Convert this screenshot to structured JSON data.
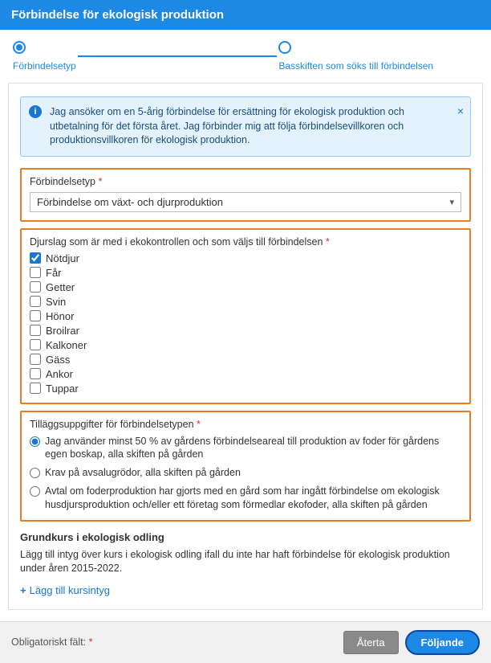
{
  "header": {
    "title": "Förbindelse för ekologisk produktion"
  },
  "stepper": {
    "step1": "Förbindelsetyp",
    "step2": "Basskiften som söks till förbindelsen"
  },
  "info": {
    "text": "Jag ansöker om en 5-årig förbindelse för ersättning för ekologisk produktion och utbetalning för det första året. Jag förbinder mig att följa förbindelsevillkoren och produktionsvillkoren för ekologisk produktion."
  },
  "forbindelsetyp": {
    "label": "Förbindelsetyp",
    "value": "Förbindelse om växt- och djurproduktion"
  },
  "djurslag": {
    "label": "Djurslag som är med i ekokontrollen och som väljs till förbindelsen",
    "items": [
      {
        "label": "Nötdjur",
        "checked": true
      },
      {
        "label": "Får",
        "checked": false
      },
      {
        "label": "Getter",
        "checked": false
      },
      {
        "label": "Svin",
        "checked": false
      },
      {
        "label": "Hönor",
        "checked": false
      },
      {
        "label": "Broilrar",
        "checked": false
      },
      {
        "label": "Kalkoner",
        "checked": false
      },
      {
        "label": "Gäss",
        "checked": false
      },
      {
        "label": "Ankor",
        "checked": false
      },
      {
        "label": "Tuppar",
        "checked": false
      }
    ]
  },
  "tillaggs": {
    "label": "Tilläggsuppgifter för förbindelsetypen",
    "options": [
      {
        "label": "Jag använder minst 50 % av gårdens förbindelseareal till produktion av foder för gårdens egen boskap, alla skiften på gården",
        "selected": true
      },
      {
        "label": "Krav på avsalugrödor, alla skiften på gården",
        "selected": false
      },
      {
        "label": "Avtal om foderproduktion har gjorts med en gård som har ingått förbindelse om ekologisk husdjursproduktion och/eller ett företag som förmedlar ekofoder, alla skiften på gården",
        "selected": false
      }
    ]
  },
  "grundkurs": {
    "heading": "Grundkurs i ekologisk odling",
    "desc": "Lägg till intyg över kurs i ekologisk odling ifall du inte har haft förbindelse för ekologisk produktion under åren 2015-2022.",
    "link": "Lägg till kursintyg"
  },
  "footer": {
    "required_label": "Obligatoriskt fält:",
    "back": "Återta",
    "next": "Följande"
  }
}
